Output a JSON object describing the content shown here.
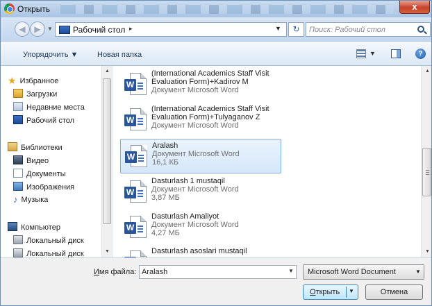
{
  "window": {
    "title": "Открыть",
    "close_label": "x"
  },
  "address": {
    "path": "Рабочий стол",
    "path_arrow": "▸",
    "search_placeholder": "Поиск: Рабочий стол"
  },
  "toolbar": {
    "organize": "Упорядочить ▼",
    "new_folder": "Новая папка",
    "help": "?"
  },
  "navigation": {
    "favorites": {
      "header": "Избранное",
      "items": [
        "Загрузки",
        "Недавние места",
        "Рабочий стол"
      ]
    },
    "libraries": {
      "header": "Библиотеки",
      "items": [
        "Видео",
        "Документы",
        "Изображения",
        "Музыка"
      ]
    },
    "computer": {
      "header": "Компьютер",
      "items": [
        "Локальный диск",
        "Локальный диск"
      ]
    }
  },
  "files": [
    {
      "name": "(International Academics Staff Visit Evaluation Form)+Kadirov M",
      "type": "Документ Microsoft Word",
      "size": "",
      "selected": false
    },
    {
      "name": "(International Academics Staff Visit Evaluation Form)+Tulyaganov Z",
      "type": "Документ Microsoft Word",
      "size": "",
      "selected": false
    },
    {
      "name": "Aralash",
      "type": "Документ Microsoft Word",
      "size": "16,1 КБ",
      "selected": true
    },
    {
      "name": "Dasturlash 1 mustaqil",
      "type": "Документ Microsoft Word",
      "size": "3,87 МБ",
      "selected": false
    },
    {
      "name": "Dasturlash Amaliyot",
      "type": "Документ Microsoft Word",
      "size": "4,27 МБ",
      "selected": false
    },
    {
      "name": "Dasturlash asoslari mustaqil",
      "type": "",
      "size": "",
      "selected": false
    }
  ],
  "footer": {
    "filename_label_accel": "И",
    "filename_label_rest": "мя файла:",
    "filename_value": "Aralash",
    "filetype_value": "Microsoft Word Document",
    "open_accel": "О",
    "open_rest": "ткрыть",
    "cancel": "Отмена"
  },
  "icons": {
    "title": "chrome-icon",
    "back": "back-arrow-icon",
    "forward": "forward-arrow-icon",
    "refresh": "refresh-icon",
    "search": "search-icon",
    "view": "view-options-icon",
    "preview_pane": "preview-pane-icon",
    "help": "help-icon",
    "file": "word-document-icon"
  },
  "colors": {
    "selection_bg": "#d5e7fa",
    "selection_border": "#84acdd",
    "link_text": "#1e395b"
  }
}
